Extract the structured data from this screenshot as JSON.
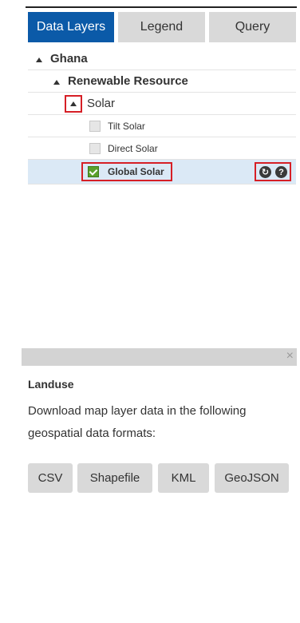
{
  "tabs": {
    "data_layers": "Data Layers",
    "legend": "Legend",
    "query": "Query"
  },
  "tree": {
    "country": "Ghana",
    "group": "Renewable Resource",
    "category": "Solar",
    "layers": [
      {
        "label": "Tilt Solar",
        "checked": false
      },
      {
        "label": "Direct Solar",
        "checked": false
      },
      {
        "label": "Global Solar",
        "checked": true
      }
    ]
  },
  "icons": {
    "download": "download-icon",
    "help": "help-icon",
    "close": "close-icon"
  },
  "dialog": {
    "close_glyph": "×",
    "title": "Landuse",
    "text": "Download map layer data in the following geospatial data formats:",
    "formats": {
      "csv": "CSV",
      "shapefile": "Shapefile",
      "kml": "KML",
      "geojson": "GeoJSON"
    }
  },
  "colors": {
    "active_tab": "#0b5aa8",
    "selected_row": "#dbe9f6",
    "highlight": "#d61f26",
    "checked": "#5aa02c"
  }
}
